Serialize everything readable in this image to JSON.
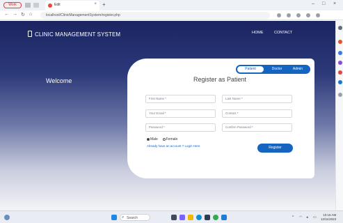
{
  "browser": {
    "tab_title": "Edit",
    "tab_close": "×",
    "new_tab": "+",
    "pill_label": "Work",
    "url": "localhost/ClinicManagementSystem/register.php",
    "window_controls": [
      "–",
      "□",
      "×"
    ],
    "nav_icons": [
      "←",
      "→",
      "↻",
      "⌂"
    ]
  },
  "site": {
    "brand": "CLINIC MANAGEMENT SYSTEM",
    "nav": [
      "HOME",
      "CONTACT"
    ]
  },
  "hero": {
    "welcome": "Welcome"
  },
  "form": {
    "title": "Register as Patient",
    "roles": [
      "Patient",
      "Doctor",
      "Admin"
    ],
    "active_role": "Patient",
    "fields": {
      "first_name": "First Name *",
      "last_name": "Last Name *",
      "email": "Your Email *",
      "contact": "Contact *",
      "password": "Password *",
      "confirm_password": "Confirm Password *"
    },
    "gender": {
      "male": "Male",
      "female": "Female"
    },
    "login_link": "Already have an account ? Login Here",
    "submit": "Register"
  },
  "taskbar": {
    "search_label": "Search",
    "time": "10:16 AM",
    "date": "12/11/2023"
  },
  "colors": {
    "accent": "#1565c0",
    "header_dark": "#1b2461"
  }
}
